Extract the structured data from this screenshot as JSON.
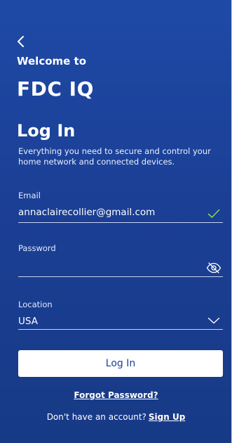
{
  "header": {
    "welcome": "Welcome to",
    "brand": "FDC IQ"
  },
  "login": {
    "title": "Log In",
    "subtitle": "Everything you need to secure and control your home network and connected devices."
  },
  "fields": {
    "email": {
      "label": "Email",
      "value": "annaclairecollier@gmail.com",
      "status_icon": "check-icon"
    },
    "password": {
      "label": "Password",
      "value": "",
      "toggle_icon": "eye-off-icon"
    },
    "location": {
      "label": "Location",
      "value": "USA",
      "dropdown_icon": "chevron-down-icon"
    }
  },
  "actions": {
    "login_label": "Log In",
    "forgot_label": "Forgot Password?",
    "no_account_text": "Don't have an account?",
    "signup_label": "Sign Up"
  },
  "colors": {
    "background": "#1c3f8f",
    "check": "#7ed957",
    "button_bg": "#ffffff",
    "button_text": "#1d4295"
  }
}
